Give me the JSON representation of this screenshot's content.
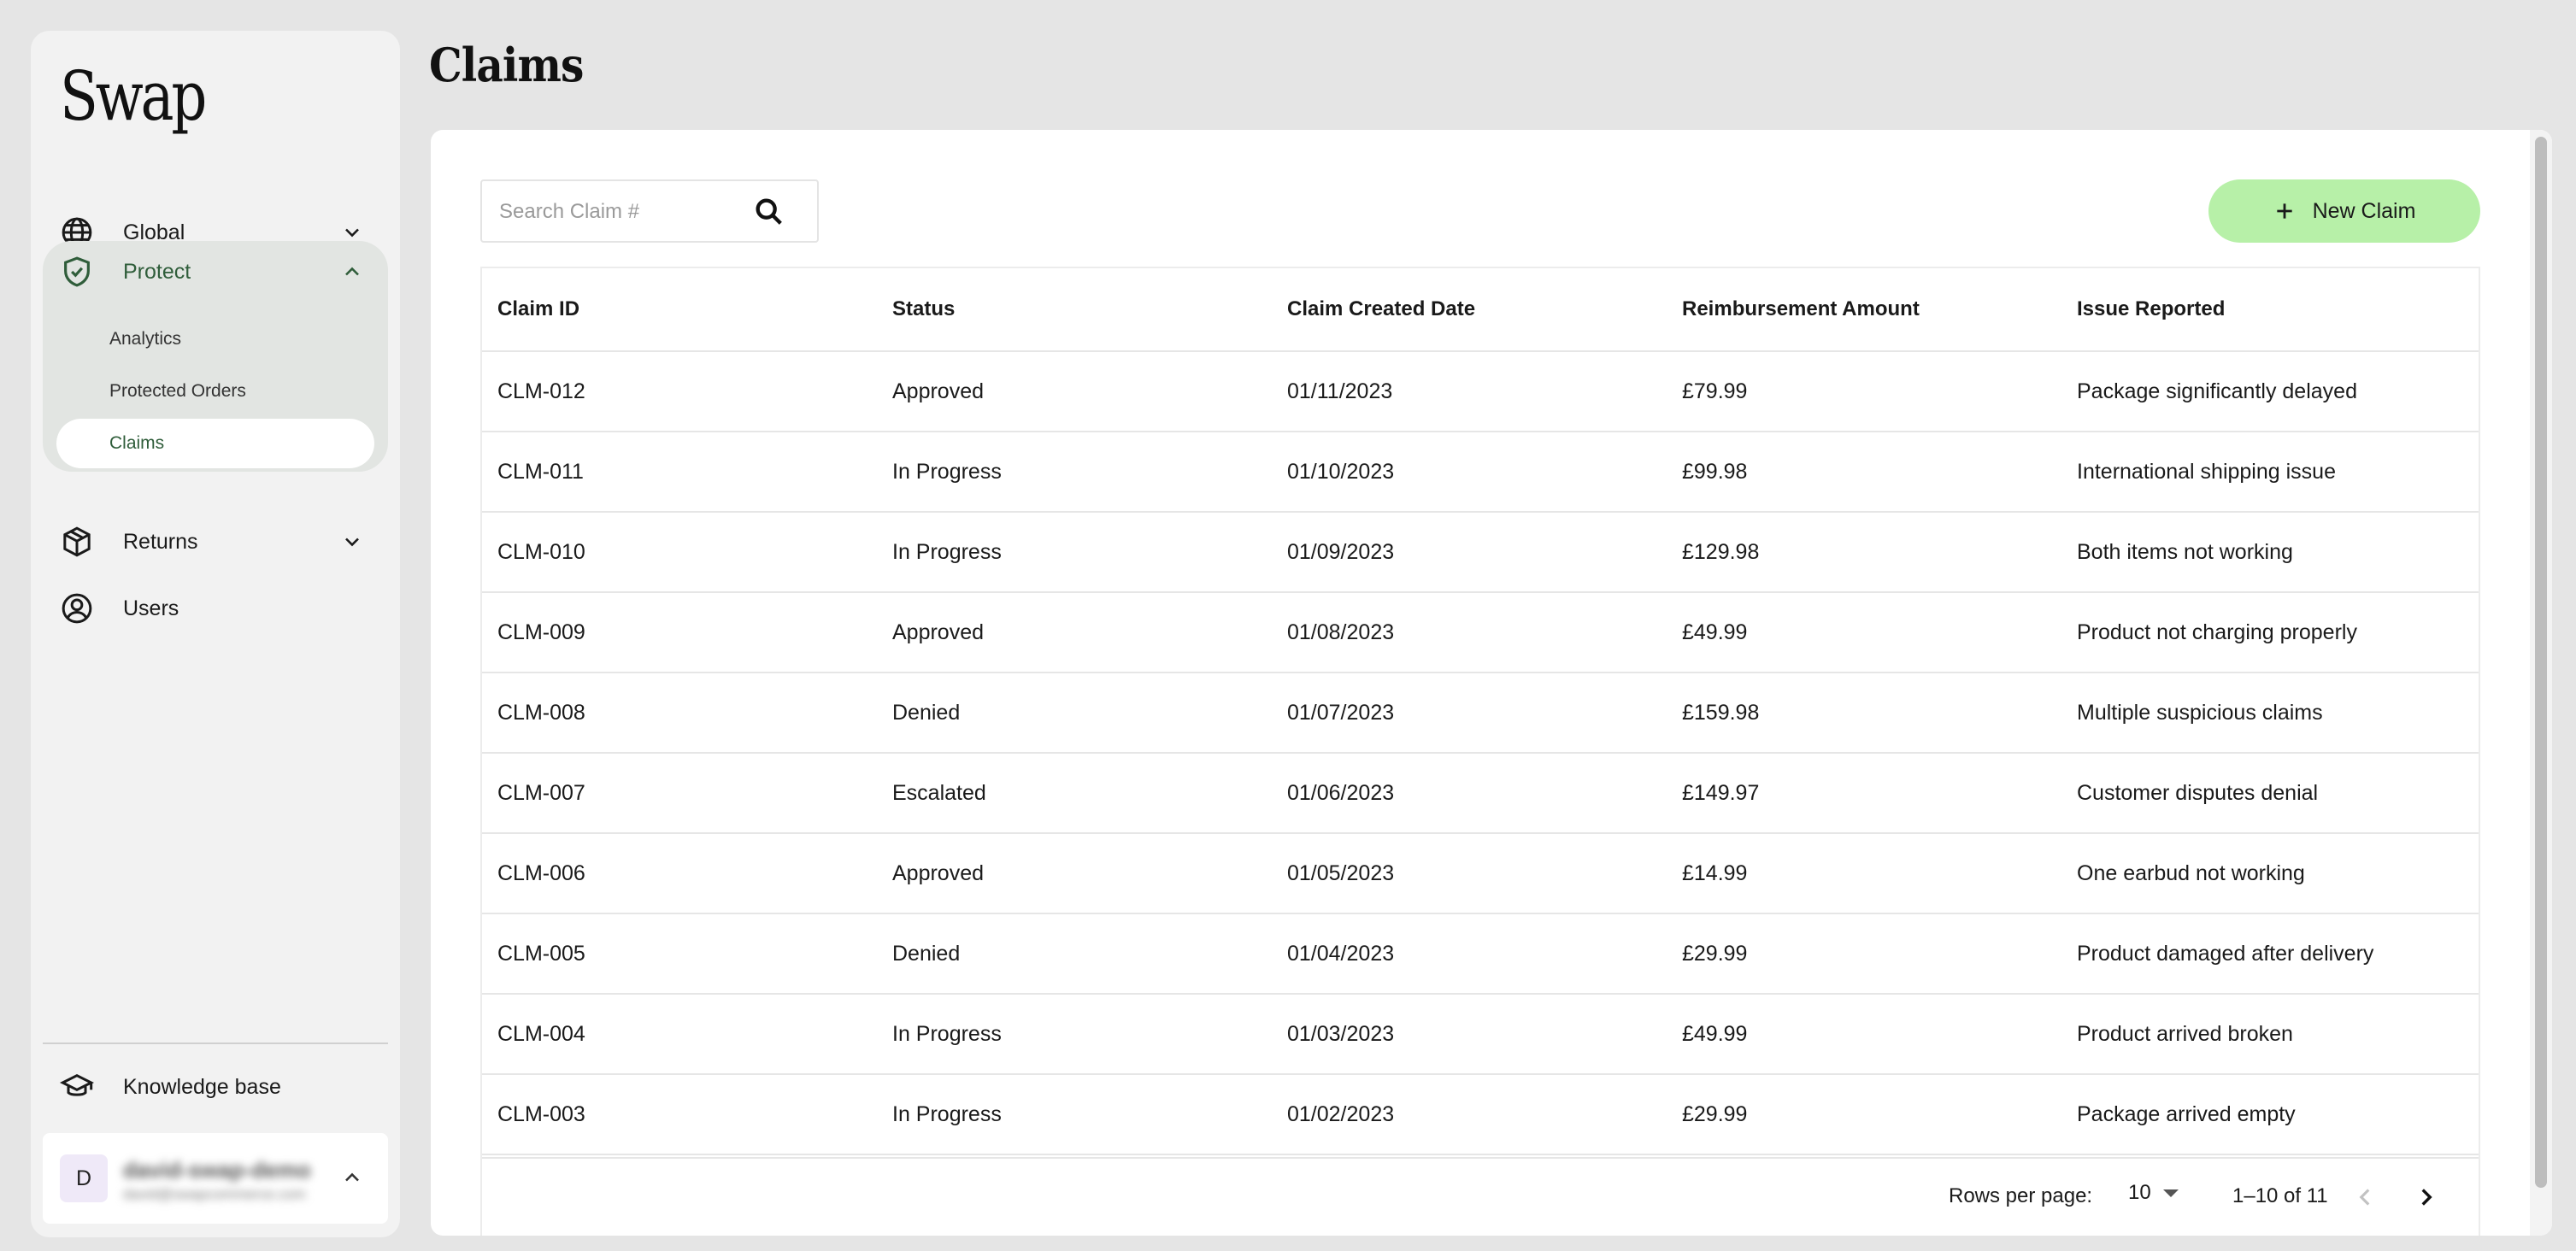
{
  "brand": {
    "logo": "Swap"
  },
  "sidebar": {
    "nav": [
      {
        "label": "Global",
        "icon": "globe-icon"
      },
      {
        "label": "Protect",
        "icon": "shield-check-icon",
        "color": "#2f5d3a"
      },
      {
        "label": "Returns",
        "icon": "box-icon"
      },
      {
        "label": "Users",
        "icon": "user-circle-icon"
      }
    ],
    "protect_sub": [
      {
        "label": "Analytics"
      },
      {
        "label": "Protected Orders"
      },
      {
        "label": "Claims",
        "active": true
      }
    ],
    "knowledge_base": "Knowledge base",
    "user": {
      "initial": "D",
      "name": "david-swap-demo",
      "email": "david@swapcommerce.com"
    }
  },
  "page": {
    "title": "Claims"
  },
  "toolbar": {
    "search_placeholder": "Search Claim #",
    "new_claim_label": "New Claim",
    "accent": "#b7f0a8"
  },
  "table": {
    "columns": [
      "Claim ID",
      "Status",
      "Claim Created Date",
      "Reimbursement Amount",
      "Issue Reported"
    ],
    "rows": [
      [
        "CLM-012",
        "Approved",
        "01/11/2023",
        "£79.99",
        "Package significantly delayed"
      ],
      [
        "CLM-011",
        "In Progress",
        "01/10/2023",
        "£99.98",
        "International shipping issue"
      ],
      [
        "CLM-010",
        "In Progress",
        "01/09/2023",
        "£129.98",
        "Both items not working"
      ],
      [
        "CLM-009",
        "Approved",
        "01/08/2023",
        "£49.99",
        "Product not charging properly"
      ],
      [
        "CLM-008",
        "Denied",
        "01/07/2023",
        "£159.98",
        "Multiple suspicious claims"
      ],
      [
        "CLM-007",
        "Escalated",
        "01/06/2023",
        "£149.97",
        "Customer disputes denial"
      ],
      [
        "CLM-006",
        "Approved",
        "01/05/2023",
        "£14.99",
        "One earbud not working"
      ],
      [
        "CLM-005",
        "Denied",
        "01/04/2023",
        "£29.99",
        "Product damaged after delivery"
      ],
      [
        "CLM-004",
        "In Progress",
        "01/03/2023",
        "£49.99",
        "Product arrived broken"
      ],
      [
        "CLM-003",
        "In Progress",
        "01/02/2023",
        "£29.99",
        "Package arrived empty"
      ]
    ]
  },
  "pagination": {
    "rows_per_page_label": "Rows per page:",
    "rows_per_page": "10",
    "range": "1–10 of 11"
  }
}
